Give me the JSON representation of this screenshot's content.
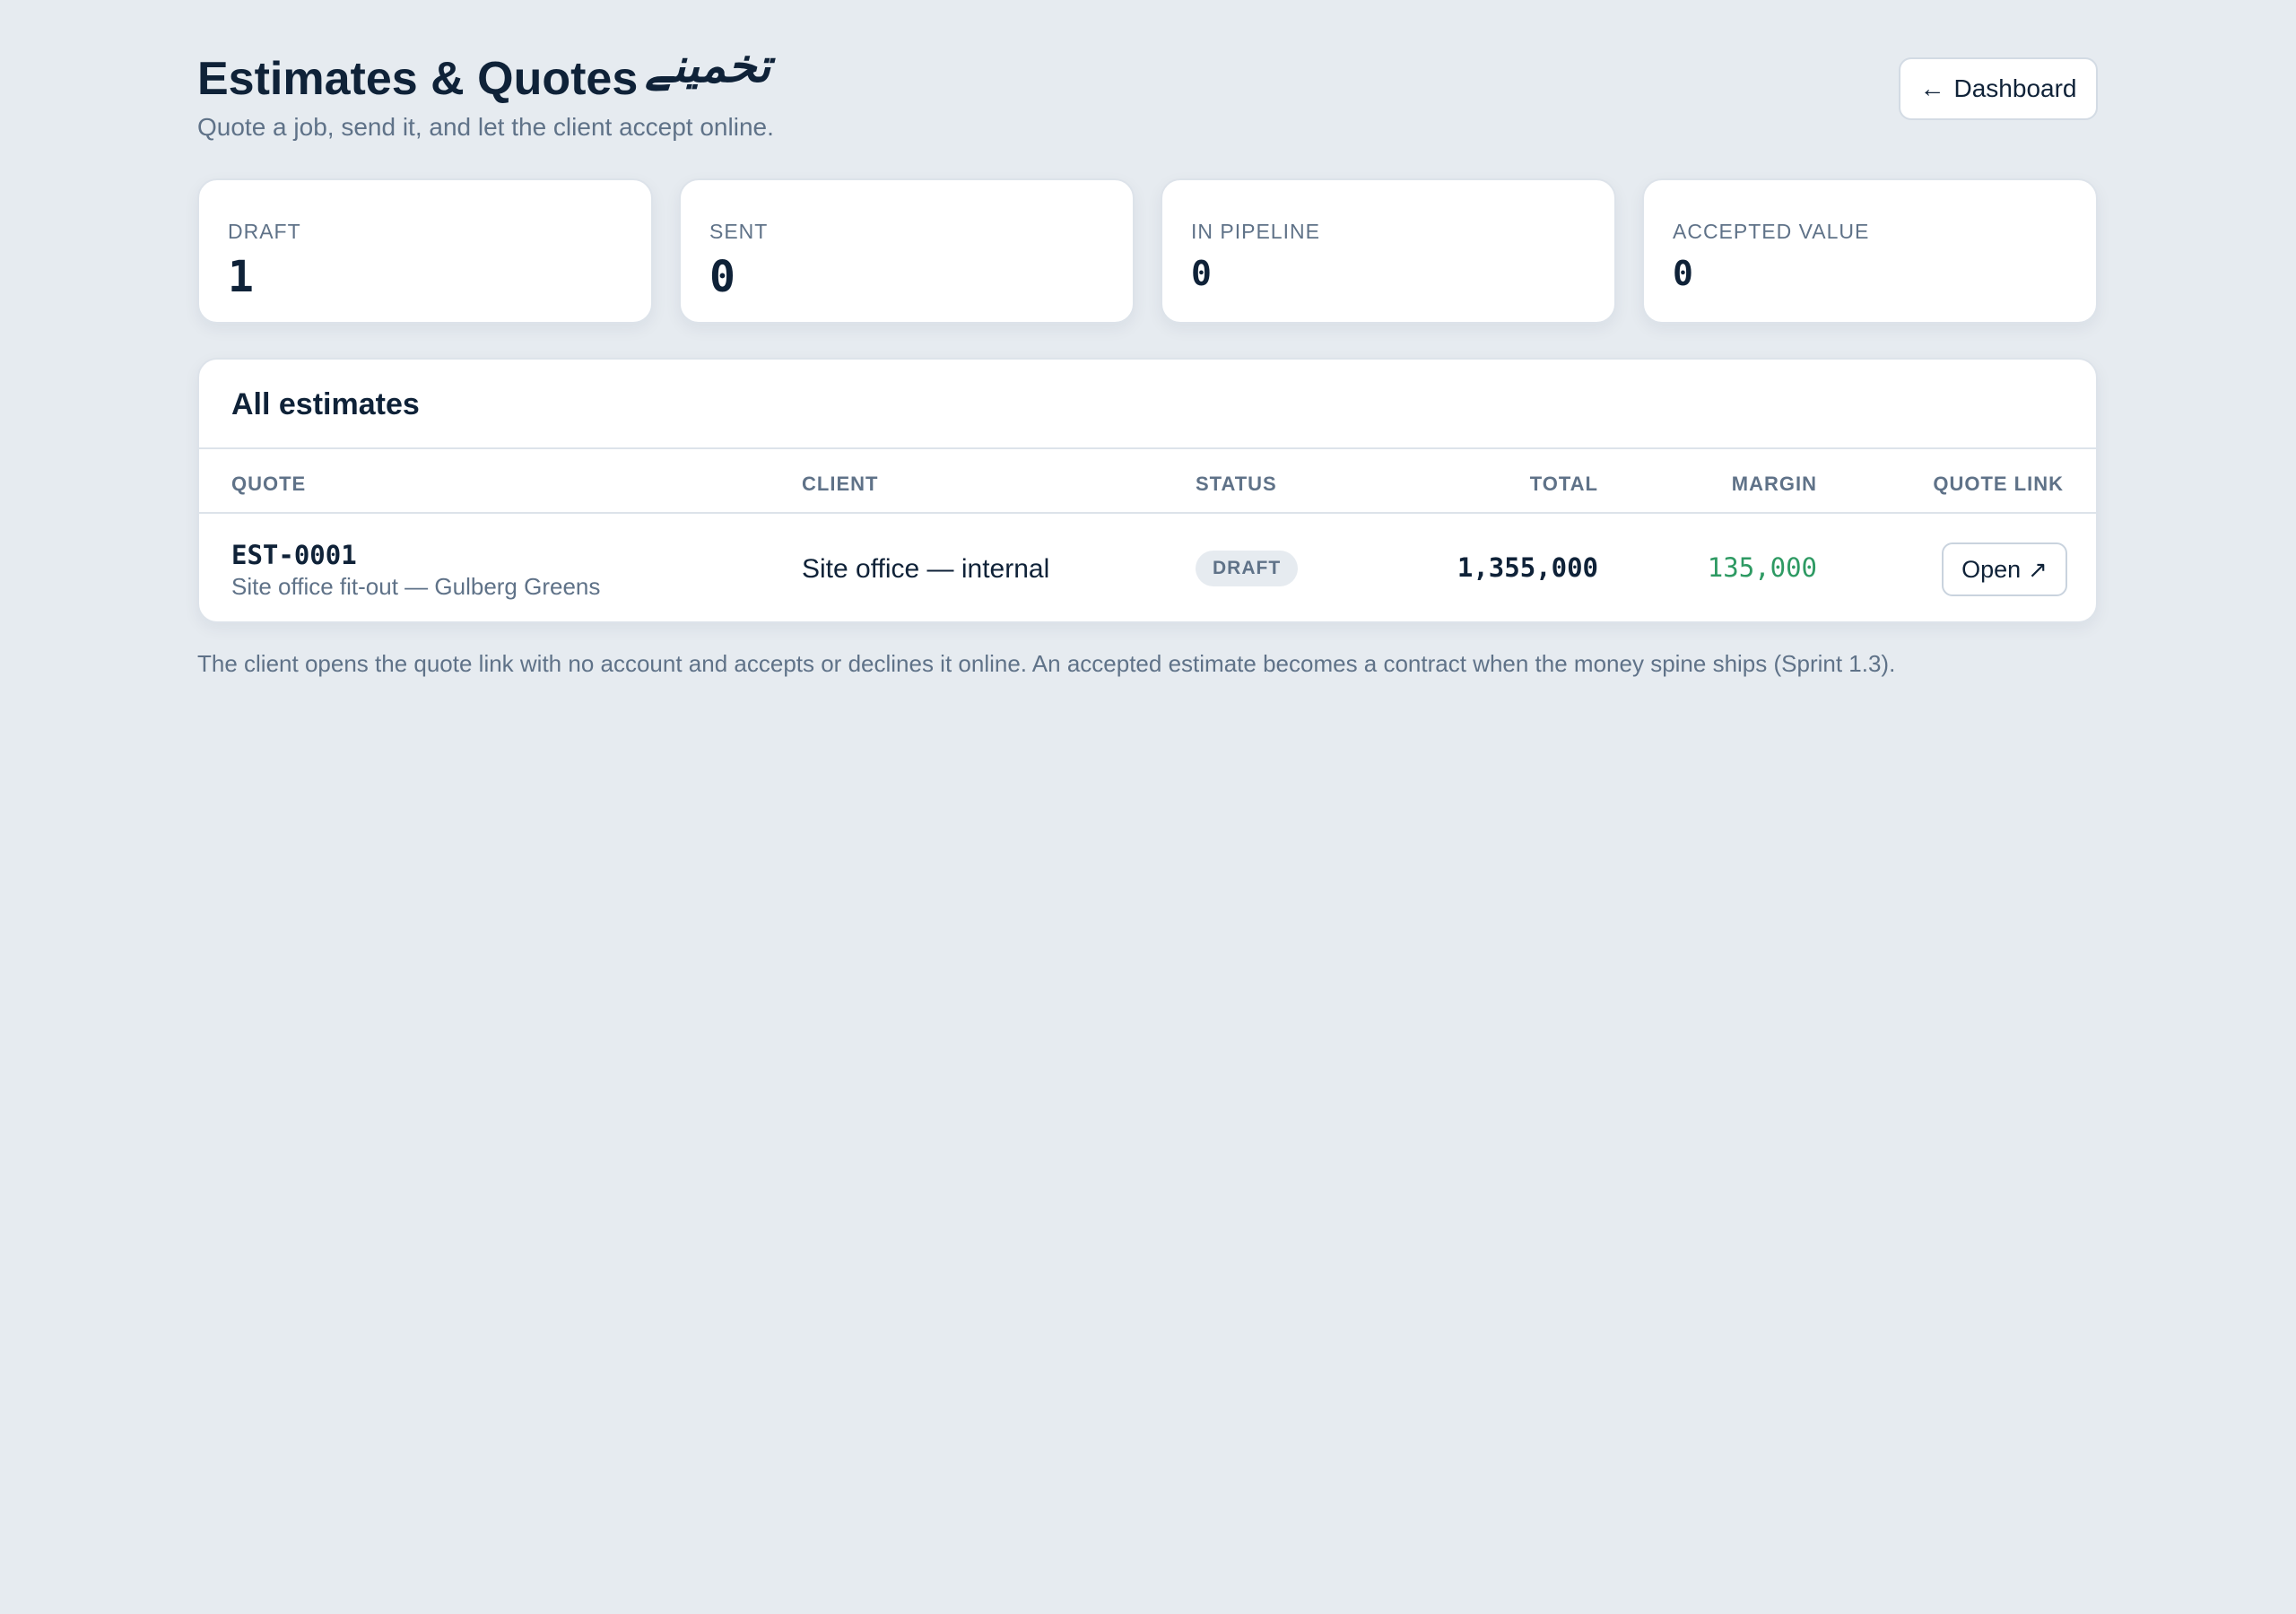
{
  "header": {
    "title": "Estimates & Quotes",
    "title_urdu": "تخمینے",
    "subtitle": "Quote a job, send it, and let the client accept online.",
    "dashboard_button": "Dashboard",
    "dashboard_icon": "arrow-left-icon"
  },
  "stats": [
    {
      "label": "DRAFT",
      "value": "1"
    },
    {
      "label": "SENT",
      "value": "0"
    },
    {
      "label": "IN PIPELINE",
      "value": "0"
    },
    {
      "label": "ACCEPTED VALUE",
      "value": "0"
    }
  ],
  "table": {
    "title": "All estimates",
    "columns": {
      "quote": "QUOTE",
      "client": "CLIENT",
      "status": "STATUS",
      "total": "TOTAL",
      "margin": "MARGIN",
      "quote_link": "QUOTE LINK"
    },
    "rows": [
      {
        "quote_id": "EST-0001",
        "description": "Site office fit-out — Gulberg Greens",
        "client": "Site office — internal",
        "status": "DRAFT",
        "total": "1,355,000",
        "margin": "135,000",
        "link_label": "Open",
        "link_icon": "external-arrow-icon"
      }
    ]
  },
  "footnote": "The client opens the quote link with no account and accepts or declines it online. An accepted estimate becomes a contract when the money spine ships (Sprint 1.3).",
  "colors": {
    "background": "#e6ebf0",
    "text": "#0f2238",
    "muted": "#5f7288",
    "margin_green": "#2e9a63"
  }
}
